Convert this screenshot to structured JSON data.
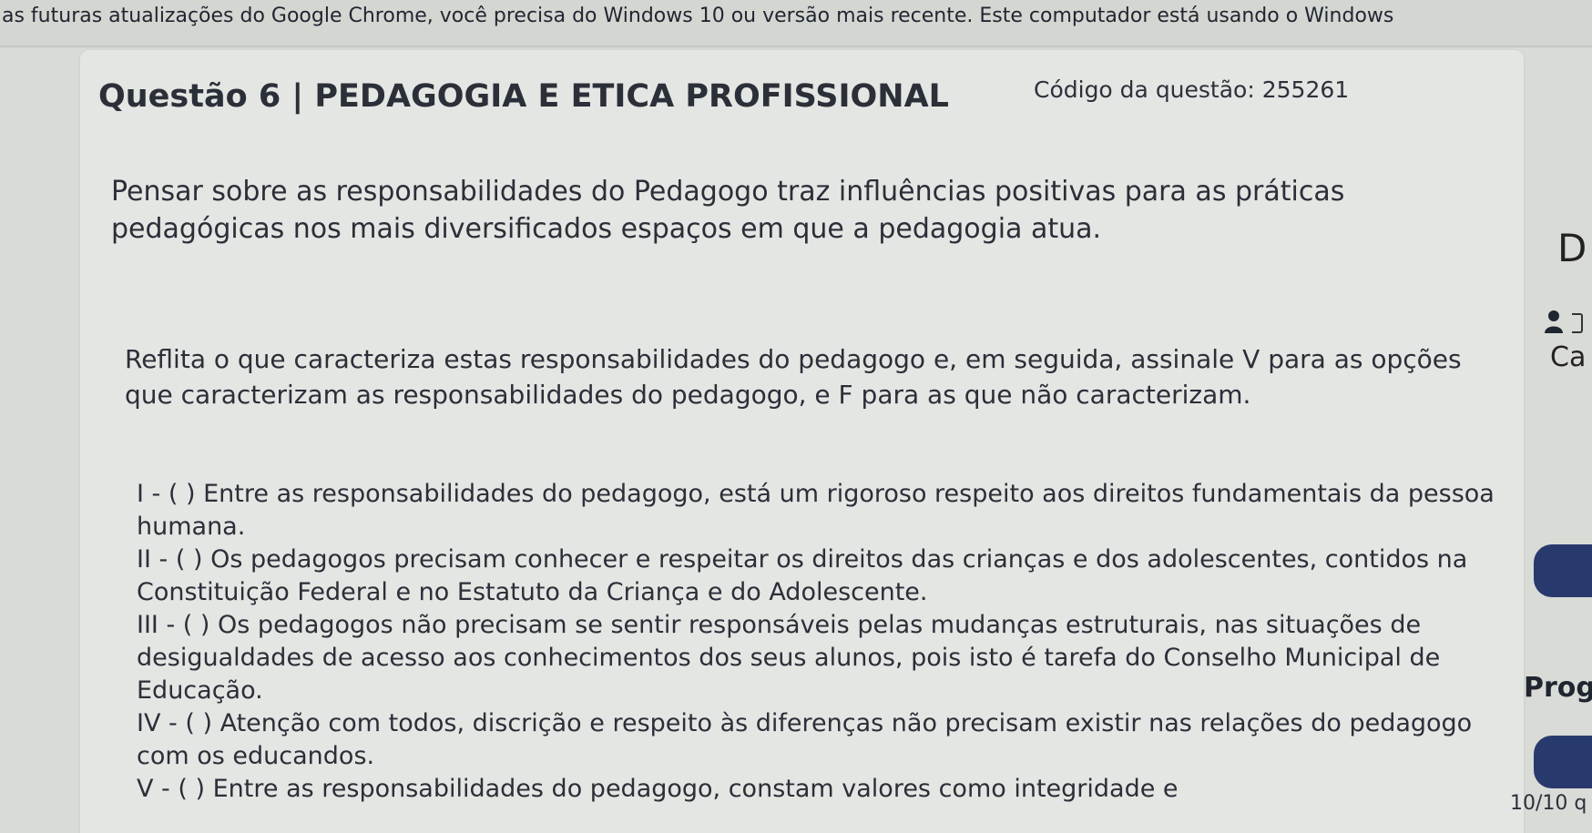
{
  "banner": {
    "text": "as futuras atualizações do Google Chrome, você precisa do Windows 10 ou versão mais recente. Este computador está usando o Windows"
  },
  "question": {
    "title": "Questão 6 | PEDAGOGIA E ETICA PROFISSIONAL",
    "code": "Código da questão: 255261",
    "intro": "Pensar sobre as responsabilidades do Pedagogo traz influências positivas para as práticas pedagógicas nos mais diversificados espaços em que a pedagogia atua.",
    "prompt": "Reflita o que caracteriza estas responsabilidades do pedagogo e, em seguida, assinale V para as opções que caracterizam as responsabilidades do pedagogo, e F para as que não caracterizam.",
    "statements": [
      "I - ( ) Entre as responsabilidades do pedagogo, está um rigoroso respeito aos direitos fundamentais da pessoa humana.",
      "II - ( ) Os pedagogos precisam conhecer e respeitar os direitos das crianças e dos adolescentes, contidos na Constituição Federal e no Estatuto da Criança e do Adolescente.",
      "III - ( ) Os pedagogos não precisam se sentir responsáveis pelas mudanças estruturais, nas situações de desigualdades de acesso aos conhecimentos dos seus alunos, pois isto é tarefa do Conselho Municipal de Educação.",
      "IV - ( ) Atenção com todos, discrição e respeito às diferenças não precisam existir nas relações do pedagogo com os educandos.",
      "V - ( ) Entre as responsabilidades do pedagogo, constam valores como integridade e"
    ]
  },
  "sidebar": {
    "d_label": "D",
    "ca_label": "Ca",
    "prog_label": "Prog",
    "count_label": "10/10 q"
  },
  "colors": {
    "pill": "#283a6d",
    "text": "#2a2f38",
    "card": "#e4e6e3"
  }
}
